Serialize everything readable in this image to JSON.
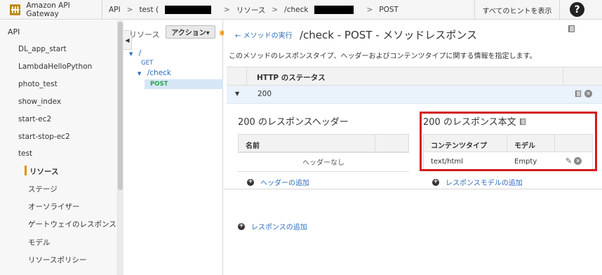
{
  "topbar": {
    "brand": "Amazon API Gateway",
    "breadcrumbs": [
      "API",
      "test (",
      "/check",
      "POST"
    ],
    "sep": ">",
    "resources_crumb": "リソース",
    "hints": "すべてのヒントを表示",
    "help": "?"
  },
  "leftnav": {
    "api_label": "API",
    "items": [
      "DL_app_start",
      "LambdaHelloPython",
      "photo_test",
      "show_index",
      "start-ec2",
      "start-stop-ec2",
      "test"
    ],
    "sub_items": [
      "リソース",
      "ステージ",
      "オーソライザー",
      "ゲートウェイのレスポンス",
      "モデル",
      "リソースポリシー"
    ]
  },
  "tree": {
    "title": "リソース",
    "action": "アクション▾",
    "root": "/",
    "get": "GET",
    "check": "/check",
    "post": "POST"
  },
  "main": {
    "back": "メソッドの実行",
    "title": "/check - POST - メソッドレスポンス",
    "description": "このメソッドのレスポンスタイプ、ヘッダーおよびコンテンツタイプに関する情報を指定します。",
    "status_header": "HTTP のステータス",
    "status_code": "200",
    "headers_title": "200 のレスポンスヘッダー",
    "headers_col_name": "名前",
    "headers_empty": "ヘッダーなし",
    "add_header": "ヘッダーの追加",
    "body_title": "200 のレスポンス本文",
    "body_col_type": "コンテンツタイプ",
    "body_col_model": "モデル",
    "body_type": "text/html",
    "body_model": "Empty",
    "add_response_model": "レスポンスモデルの追加",
    "add_response": "レスポンスの追加"
  },
  "colors": {
    "accent": "#2a6bbf",
    "highlight": "#d21b1b",
    "active": "#e98c00"
  }
}
